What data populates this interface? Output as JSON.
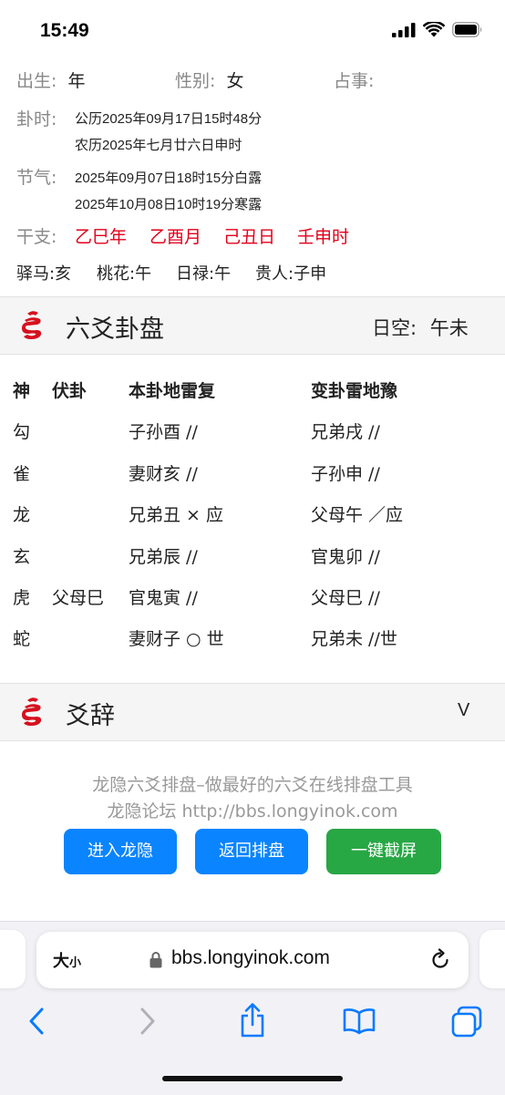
{
  "status_bar": {
    "time": "15:49"
  },
  "info": {
    "birth_label": "出生:",
    "birth_value": "年",
    "gender_label": "性别:",
    "gender_value": "女",
    "matter_label": "占事:",
    "matter_value": "",
    "guashi_label": "卦时:",
    "guashi_solar": "公历2025年09月17日15时48分",
    "guashi_lunar": "农历2025年七月廿六日申时",
    "jieqi_label": "节气:",
    "jieqi_1": "2025年09月07日18时15分白露",
    "jieqi_2": "2025年10月08日10时19分寒露",
    "ganzhi_label": "干支:",
    "ganzhi": [
      "乙巳年",
      "乙酉月",
      "己丑日",
      "壬申时"
    ],
    "misc": [
      "驿马:亥",
      "桃花:午",
      "日禄:午",
      "贵人:子申"
    ]
  },
  "gua_section": {
    "title": "六爻卦盘",
    "rikong_label": "日空:",
    "rikong_value": "午未",
    "headers": [
      "神",
      "伏卦",
      "本卦地雷复",
      "变卦雷地豫"
    ],
    "rows": [
      {
        "shen": "勾",
        "fu": "",
        "ben": "子孙酉 //",
        "bian": "兄弟戌 //"
      },
      {
        "shen": "雀",
        "fu": "",
        "ben": "妻财亥 //",
        "bian": "子孙申 //"
      },
      {
        "shen": "龙",
        "fu": "",
        "ben": "兄弟丑 × 应",
        "bian": "父母午 ／应"
      },
      {
        "shen": "玄",
        "fu": "",
        "ben": "兄弟辰 //",
        "bian": "官鬼卯 //"
      },
      {
        "shen": "虎",
        "fu": "父母巳",
        "ben": "官鬼寅 //",
        "bian": "父母巳 //"
      },
      {
        "shen": "蛇",
        "fu": "",
        "ben": "妻财子 ○ 世",
        "bian": "兄弟未 //世"
      }
    ]
  },
  "yaoci_section": {
    "title": "爻辞",
    "toggle": "V"
  },
  "footer": {
    "line1": "龙隐六爻排盘–做最好的六爻在线排盘工具",
    "line2": "龙隐论坛 http://bbs.longyinok.com",
    "btn_enter": "进入龙隐",
    "btn_back": "返回排盘",
    "btn_screenshot": "一键截屏"
  },
  "browser": {
    "size_label": "大",
    "size_small": "小",
    "url": "bbs.longyinok.com"
  },
  "colors": {
    "red": "#e0001b",
    "blue_button": "#0a84ff",
    "green_button": "#28a745",
    "ios_blue": "#0a7aff"
  }
}
